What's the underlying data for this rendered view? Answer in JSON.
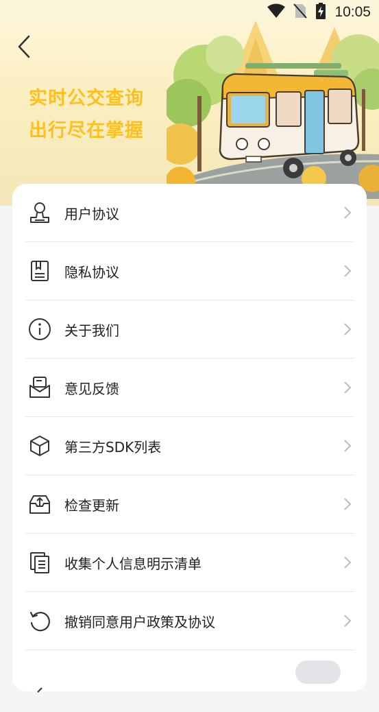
{
  "status_bar": {
    "time": "10:05"
  },
  "header": {
    "slogan_line1": "实时公交查询",
    "slogan_line2": "出行尽在掌握",
    "accent_color": "#ffbf1f"
  },
  "menu": {
    "items": [
      {
        "label": "用户协议",
        "icon": "user-agreement-icon"
      },
      {
        "label": "隐私协议",
        "icon": "privacy-agreement-icon"
      },
      {
        "label": "关于我们",
        "icon": "info-icon"
      },
      {
        "label": "意见反馈",
        "icon": "feedback-icon"
      },
      {
        "label": "第三方SDK列表",
        "icon": "sdk-cube-icon"
      },
      {
        "label": "检查更新",
        "icon": "update-icon"
      },
      {
        "label": "收集个人信息明示清单",
        "icon": "document-list-icon"
      },
      {
        "label": "撤销同意用户政策及协议",
        "icon": "revoke-icon"
      }
    ]
  }
}
